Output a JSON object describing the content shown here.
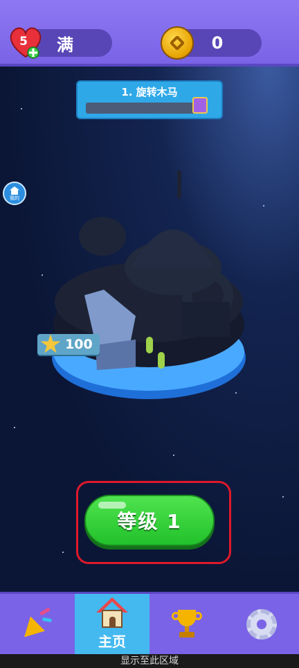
{
  "header": {
    "lives": {
      "count": "5",
      "status": "满"
    },
    "coins": {
      "value": "0"
    }
  },
  "progress": {
    "title": "1. 旋转木马",
    "fraction": 0.0
  },
  "side_badge": {
    "label": "我的"
  },
  "island": {
    "star_cost": "100"
  },
  "level_button": {
    "label": "等级 1"
  },
  "bottom_nav": {
    "items": [
      {
        "name": "party",
        "icon": "party-popper-icon"
      },
      {
        "name": "home",
        "label": "主页",
        "icon": "house-icon"
      },
      {
        "name": "leaderboard",
        "icon": "trophy-icon"
      },
      {
        "name": "settings",
        "icon": "gear-icon"
      }
    ],
    "active": "home"
  },
  "system_strip": {
    "text": "显示至此区域"
  },
  "colors": {
    "topbar": "#7a63e6",
    "nav_active": "#44b9f0",
    "level_button": "#2ad22f",
    "highlight": "#e0192b"
  }
}
